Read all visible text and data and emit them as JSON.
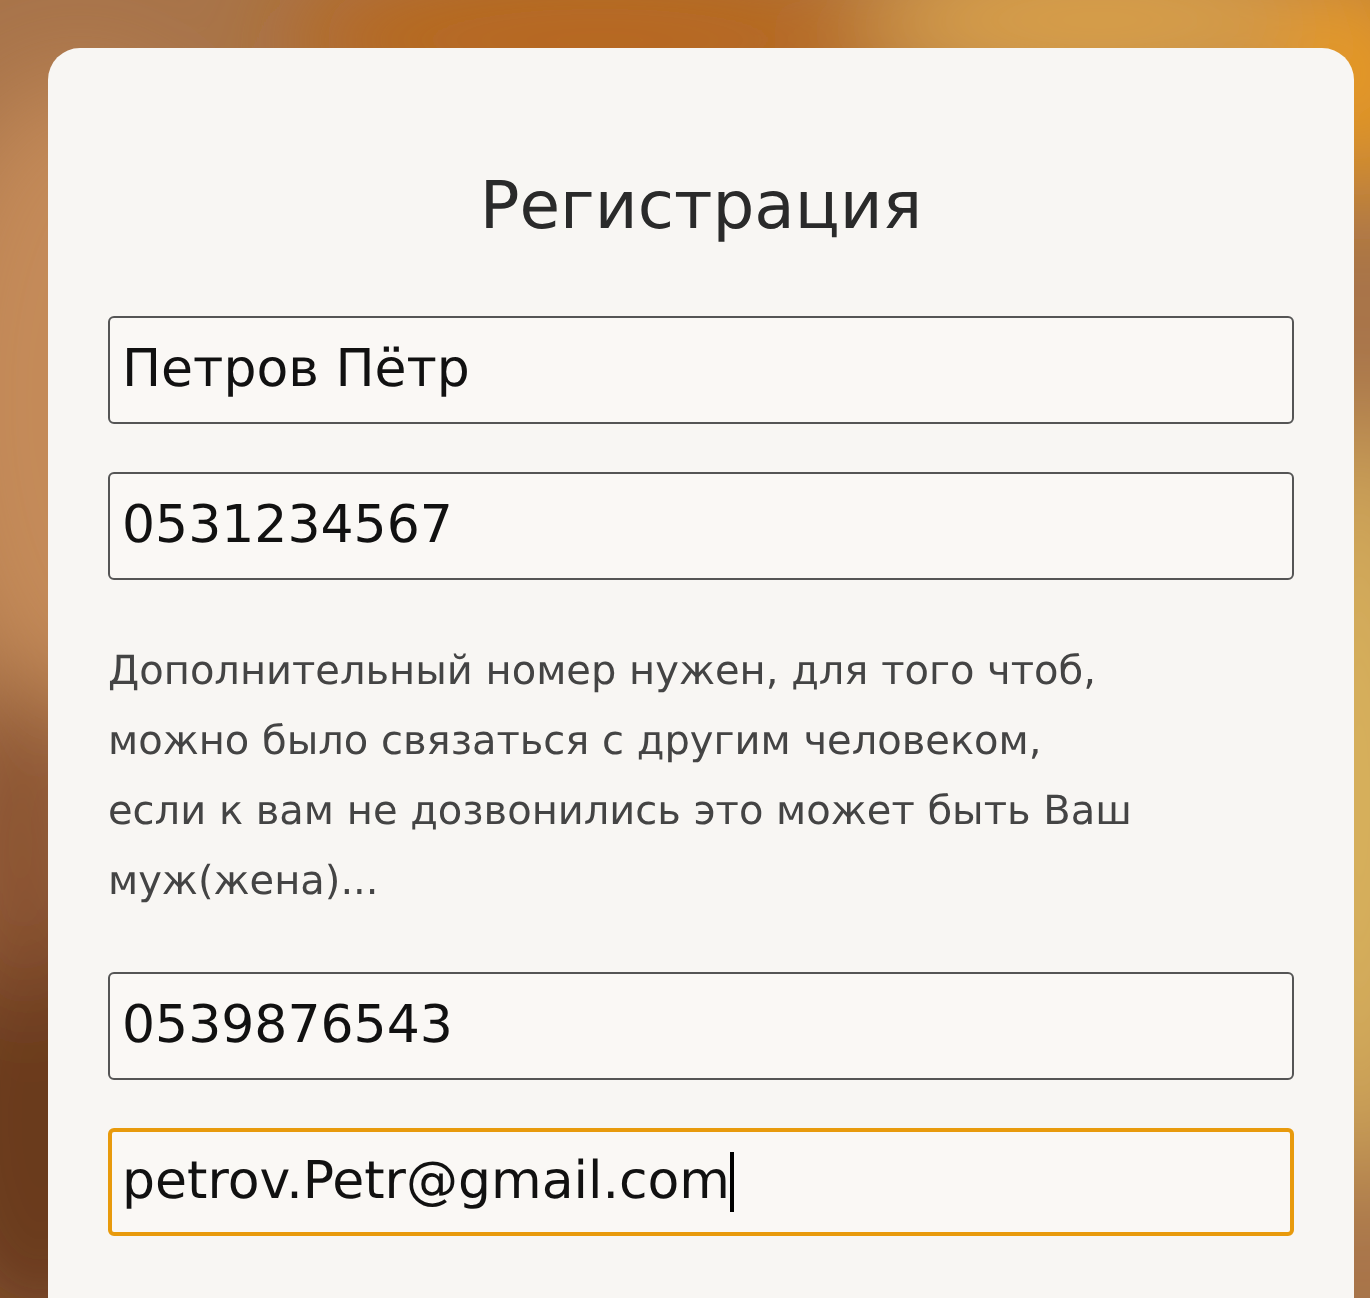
{
  "form": {
    "title": "Регистрация",
    "items": [
      {
        "kind": "input",
        "value": "Петров Пётр",
        "focused": false
      },
      {
        "kind": "input",
        "value": "0531234567",
        "focused": false
      },
      {
        "kind": "note",
        "text": "Дополнительный номер нужен, для того чтоб, можно было связаться с другим человеком, если к вам не дозвонились это может быть Ваш муж(жена)..."
      },
      {
        "kind": "input",
        "value": "0539876543",
        "focused": false
      },
      {
        "kind": "input",
        "value": "petrov.Petr@gmail.com",
        "focused": true
      }
    ]
  }
}
